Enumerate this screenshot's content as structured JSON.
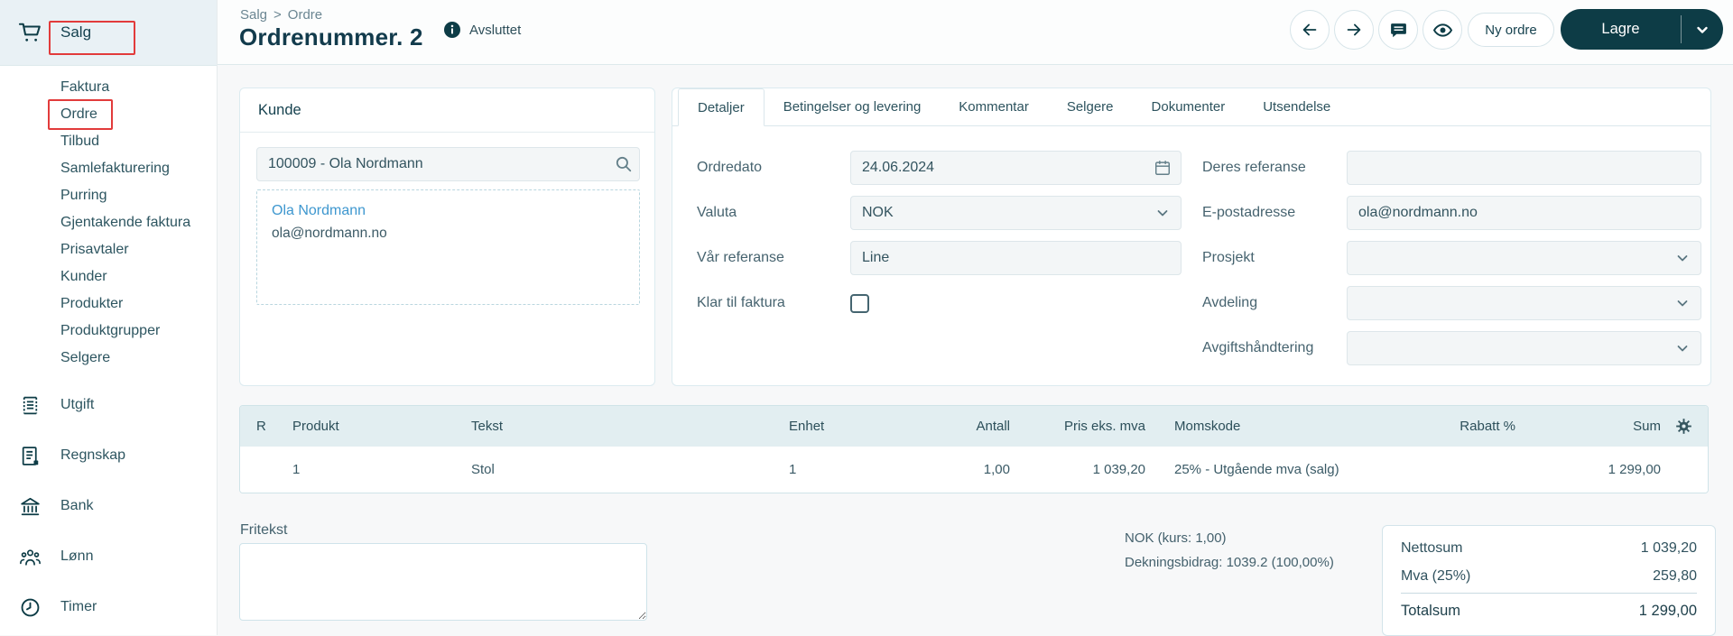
{
  "colors": {
    "accent": "#0d3c46",
    "annotation_red": "#e23b3b",
    "link_blue": "#3e97cf",
    "sidebar_band_bg": "#e9f1f5",
    "table_header_bg": "#e2eef1",
    "input_bg": "#f3f6f7",
    "page_bg": "#f7f8f9"
  },
  "sidebar": {
    "top": {
      "label": "Salg",
      "icon": "cart-icon"
    },
    "items": [
      {
        "label": "Faktura"
      },
      {
        "label": "Ordre"
      },
      {
        "label": "Tilbud"
      },
      {
        "label": "Samlefakturering"
      },
      {
        "label": "Purring"
      },
      {
        "label": "Gjentakende faktura"
      },
      {
        "label": "Prisavtaler"
      },
      {
        "label": "Kunder"
      },
      {
        "label": "Produkter"
      },
      {
        "label": "Produktgrupper"
      },
      {
        "label": "Selgere"
      }
    ],
    "modules": [
      {
        "label": "Utgift",
        "icon": "receipt-icon"
      },
      {
        "label": "Regnskap",
        "icon": "ledger-icon"
      },
      {
        "label": "Bank",
        "icon": "bank-icon"
      },
      {
        "label": "Lønn",
        "icon": "people-icon"
      },
      {
        "label": "Timer",
        "icon": "clock-icon"
      }
    ]
  },
  "header": {
    "breadcrumb": {
      "part1": "Salg",
      "separator": ">",
      "part2": "Ordre"
    },
    "title": "Ordrenummer. 2",
    "status_label": "Avsluttet",
    "new_order_label": "Ny ordre",
    "save_label": "Lagre"
  },
  "customer": {
    "panel_title": "Kunde",
    "search_value": "100009 - Ola Nordmann",
    "name": "Ola Nordmann",
    "email": "ola@nordmann.no"
  },
  "tabs": {
    "items": [
      {
        "label": "Detaljer",
        "active": true
      },
      {
        "label": "Betingelser og levering",
        "active": false
      },
      {
        "label": "Kommentar",
        "active": false
      },
      {
        "label": "Selgere",
        "active": false
      },
      {
        "label": "Dokumenter",
        "active": false
      },
      {
        "label": "Utsendelse",
        "active": false
      }
    ]
  },
  "form": {
    "ordredato": {
      "label": "Ordredato",
      "value": "24.06.2024"
    },
    "valuta": {
      "label": "Valuta",
      "value": "NOK"
    },
    "var_referanse": {
      "label": "Vår referanse",
      "value": "Line"
    },
    "klar_til_faktura": {
      "label": "Klar til faktura",
      "checked": false
    },
    "deres_referanse": {
      "label": "Deres referanse",
      "value": ""
    },
    "epostadresse": {
      "label": "E-postadresse",
      "value": "ola@nordmann.no"
    },
    "prosjekt": {
      "label": "Prosjekt",
      "value": ""
    },
    "avdeling": {
      "label": "Avdeling",
      "value": ""
    },
    "avgiftshandtering": {
      "label": "Avgiftshåndtering",
      "value": ""
    }
  },
  "lines_table": {
    "columns": [
      {
        "label": "R"
      },
      {
        "label": "Produkt"
      },
      {
        "label": "Tekst"
      },
      {
        "label": "Enhet"
      },
      {
        "label": "Antall"
      },
      {
        "label": "Pris eks. mva"
      },
      {
        "label": "Momskode"
      },
      {
        "label": "Rabatt %"
      },
      {
        "label": "Sum"
      }
    ],
    "rows": [
      {
        "r": "",
        "produkt": "1",
        "tekst": "Stol",
        "enhet": "1",
        "antall": "1,00",
        "pris_eks_mva": "1 039,20",
        "momskode": "25% - Utgående mva (salg)",
        "rabatt": "",
        "sum": "1 299,00"
      }
    ]
  },
  "footer": {
    "fritekst_label": "Fritekst",
    "currency_note": "NOK (kurs: 1,00)",
    "contribution_note": "Dekningsbidrag: 1039.2 (100,00%)",
    "totals": {
      "net": {
        "label": "Nettosum",
        "value": "1 039,20"
      },
      "vat": {
        "label": "Mva (25%)",
        "value": "259,80"
      },
      "total": {
        "label": "Totalsum",
        "value": "1 299,00"
      }
    }
  }
}
